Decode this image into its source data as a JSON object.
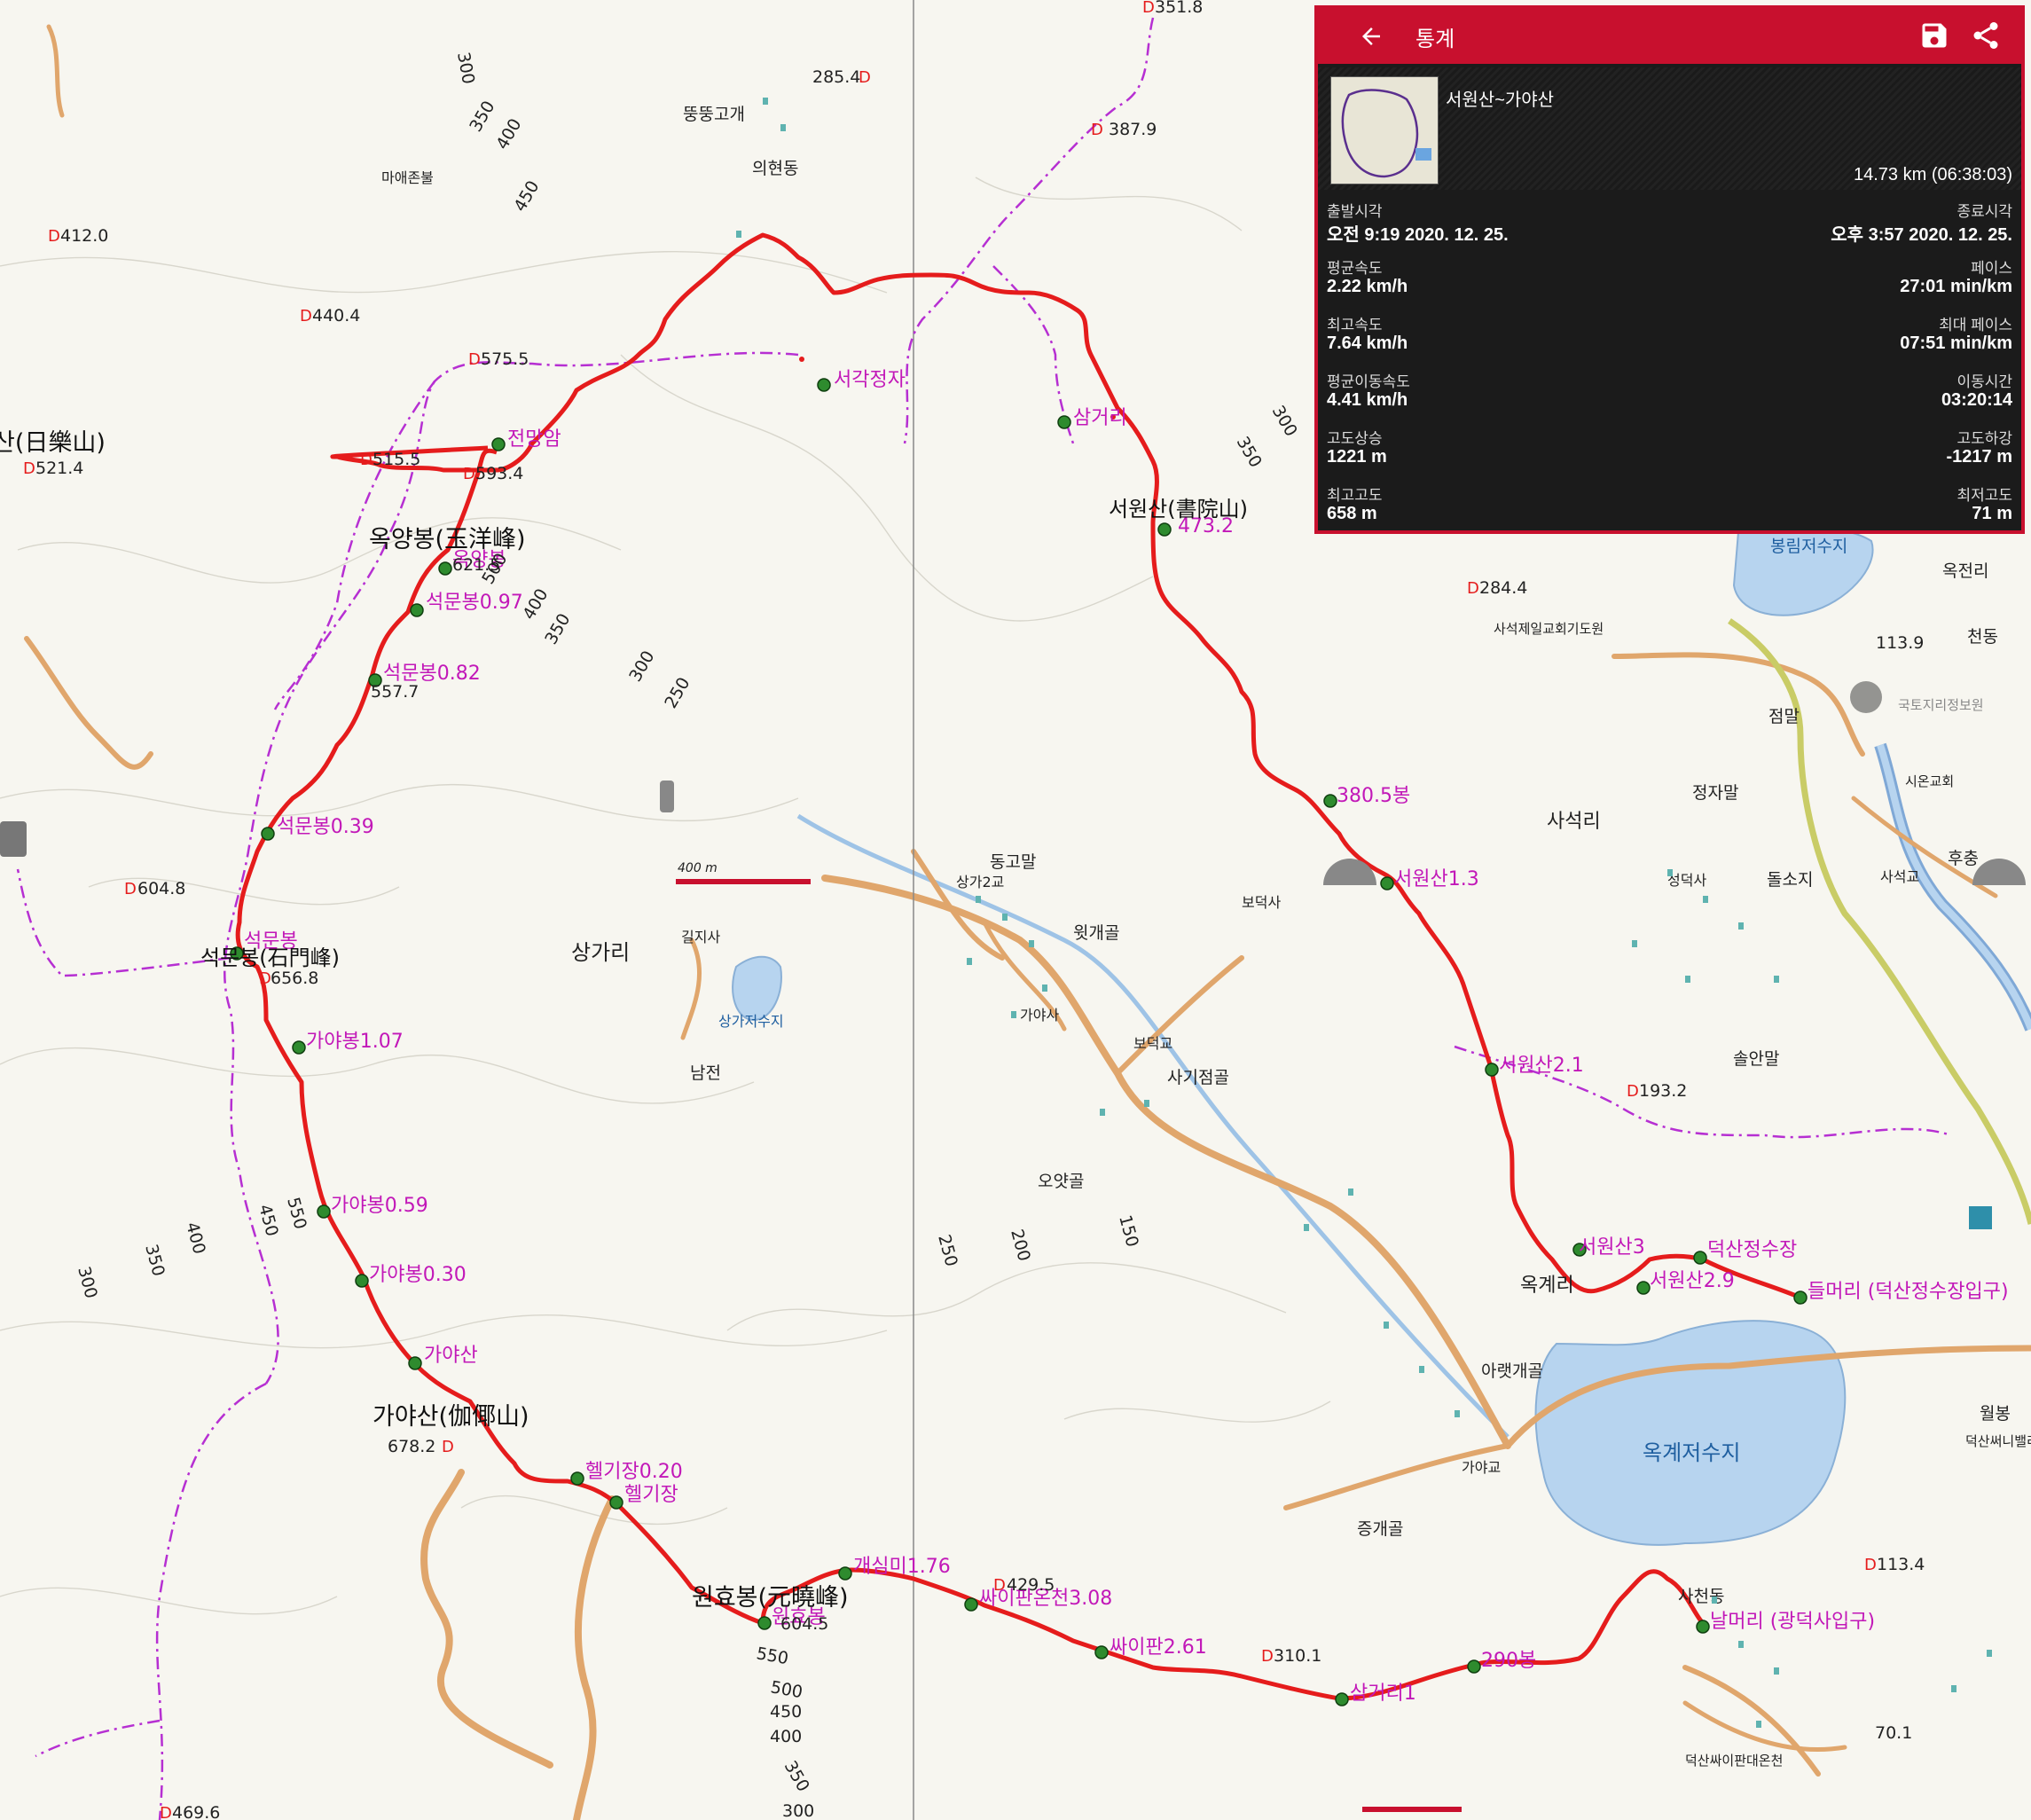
{
  "stats_panel": {
    "title": "통계",
    "back_icon": "arrow-left-icon",
    "save_icon": "save-icon",
    "share_icon": "share-icon",
    "track_name": "서원산~가야산",
    "track_summary": "14.73 km (06:38:03)",
    "rows": [
      {
        "left_label": "출발시각",
        "left_value": "오전 9:19 2020. 12. 25.",
        "right_label": "종료시각",
        "right_value": "오후 3:57 2020. 12. 25."
      },
      {
        "left_label": "평균속도",
        "left_value": "2.22 km/h",
        "right_label": "페이스",
        "right_value": "27:01 min/km"
      },
      {
        "left_label": "최고속도",
        "left_value": "7.64 km/h",
        "right_label": "최대 페이스",
        "right_value": "07:51 min/km"
      },
      {
        "left_label": "평균이동속도",
        "left_value": "4.41 km/h",
        "right_label": "이동시간",
        "right_value": "03:20:14"
      },
      {
        "left_label": "고도상승",
        "left_value": "1221 m",
        "right_label": "고도하강",
        "right_value": "-1217 m"
      },
      {
        "left_label": "최고고도",
        "left_value": "658 m",
        "right_label": "최저고도",
        "right_value": "71 m"
      }
    ]
  },
  "colors": {
    "track": "#e51c1c",
    "waypoint": "#2e8b2e",
    "waypoint_label": "#c218b8",
    "boundary": "#b62fd2",
    "road": "#e0a66c",
    "highway": "#c9cc66",
    "water": "#b7d4ef",
    "river": "#7fa8d6",
    "panel_accent": "#c8102e"
  },
  "map": {
    "scale_label": "400 m",
    "waypoints": [
      {
        "label": "서각정자"
      },
      {
        "label": "삼거리"
      },
      {
        "label": "서원산(書院山)"
      },
      {
        "label": "473.2"
      },
      {
        "label": "380.5봉"
      },
      {
        "label": "서원산1.3"
      },
      {
        "label": "서원산2.1"
      },
      {
        "label": "서원산3"
      },
      {
        "label": "서원산2.9"
      },
      {
        "label": "덕산정수장"
      },
      {
        "label": "들머리 (덕산정수장입구)"
      },
      {
        "label": "전망암"
      },
      {
        "label": "옥양봉"
      },
      {
        "label": "석문봉0.97"
      },
      {
        "label": "석문봉0.82"
      },
      {
        "label": "석문봉0.39"
      },
      {
        "label": "석문봉"
      },
      {
        "label": "가야봉1.07"
      },
      {
        "label": "가야봉0.59"
      },
      {
        "label": "가야봉0.30"
      },
      {
        "label": "가야산"
      },
      {
        "label": "헬기장0.20"
      },
      {
        "label": "헬기장"
      },
      {
        "label": "원효봉"
      },
      {
        "label": "개심미1.76"
      },
      {
        "label": "싸이판온천3.08"
      },
      {
        "label": "싸이판2.61"
      },
      {
        "label": "삼거리1"
      },
      {
        "label": "290봉"
      },
      {
        "label": "날머리 (광덕사입구)"
      }
    ],
    "peaks": [
      {
        "label": "옥양봉(玉洋峰)"
      },
      {
        "label": "석문봉(石門峰)"
      },
      {
        "label": "가야산(伽倻山)"
      },
      {
        "label": "원효봉(元曉峰)"
      },
      {
        "label": "산(日樂山)"
      }
    ],
    "elevations": [
      "351.8",
      "387.9",
      "285.4",
      "412.0",
      "440.4",
      "575.5",
      "515.5",
      "593.4",
      "521.4",
      "621.5",
      "557.7",
      "604.8",
      "656.8",
      "678.2",
      "604.5",
      "429.5",
      "310.1",
      "469.6",
      "284.4",
      "193.2",
      "113.9",
      "113.4",
      "70.1"
    ],
    "contours": [
      "300",
      "350",
      "400",
      "450",
      "400",
      "350",
      "300",
      "250",
      "500",
      "550",
      "450",
      "400",
      "350",
      "300",
      "550",
      "500",
      "450",
      "400",
      "350",
      "300",
      "250",
      "200",
      "150",
      "300",
      "350"
    ],
    "places": [
      "뚱뚱고개",
      "의현동",
      "마애존불",
      "상가리",
      "동고말",
      "상가2교",
      "윗개골",
      "가야사",
      "보덕교",
      "보덕사",
      "사기점골",
      "오얏골",
      "길지사",
      "상가저수지",
      "남전",
      "사석리",
      "정자말",
      "점말",
      "성덕사",
      "돌소지",
      "사석교",
      "후충",
      "솔안말",
      "사석제일교회기도원",
      "옥전리",
      "천동",
      "시온교회",
      "국토지리정보원",
      "봉림저수지",
      "옥계리",
      "아랫개골",
      "가야교",
      "옥계저수지",
      "증개골",
      "사천동",
      "월봉",
      "덕산써니밸리",
      "덕산싸이판대온천"
    ]
  }
}
